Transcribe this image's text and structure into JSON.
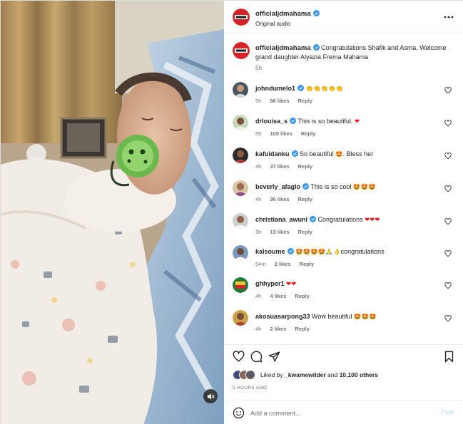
{
  "post": {
    "author": "officialjdmahama",
    "audio": "Original audio",
    "caption": "Congratulations Shafik and Asma. Welcome grand daughter Alyazia Frema Mahama",
    "caption_time": "5h"
  },
  "comments": [
    {
      "user": "johndumelo1",
      "text": "",
      "emoji": "👏👏👏👏👏",
      "time": "5h",
      "likes": "86 likes",
      "reply": "Reply",
      "verified": true
    },
    {
      "user": "drlouisa_s",
      "text": "This is so beautiful. ",
      "emoji": "❤",
      "time": "5h",
      "likes": "105 likes",
      "reply": "Reply",
      "verified": true
    },
    {
      "user": "kafuidanku",
      "text": "So beautiful ",
      "emoji": "🤩",
      "text2": ". Bless her",
      "time": "4h",
      "likes": "37 likes",
      "reply": "Reply",
      "verified": true
    },
    {
      "user": "beverly_afaglo",
      "text": "This is so cool ",
      "emoji": "🤩🤩🤩",
      "time": "4h",
      "likes": "36 likes",
      "reply": "Reply",
      "verified": true
    },
    {
      "user": "christiana_awuni",
      "text": "Congratulations ",
      "emoji": "❤❤❤",
      "time": "3h",
      "likes": "13 likes",
      "reply": "Reply",
      "verified": true
    },
    {
      "user": "kalsoume",
      "text": "",
      "emoji": "🤩🤩🤩🤩🙏👌",
      "text2": "congratulations",
      "time": "54m",
      "likes": "2 likes",
      "reply": "Reply",
      "verified": true
    },
    {
      "user": "ghhyper1",
      "text": "",
      "emoji": "❤❤",
      "time": "4h",
      "likes": "4 likes",
      "reply": "Reply",
      "verified": false
    },
    {
      "user": "akosuasarpong33",
      "text": "Wow beautiful ",
      "emoji": "🤩🤩🤩",
      "time": "4h",
      "likes": "2 likes",
      "reply": "Reply",
      "verified": false
    }
  ],
  "likes": {
    "prefix": "Liked by ",
    "user": "_kwamewilder",
    "middle": " and ",
    "others": "10,100 others"
  },
  "posted_ago": "5 HOURS AGO",
  "composer": {
    "placeholder": "Add a comment...",
    "post_label": "Post"
  },
  "icons": {
    "more": "more-options-icon",
    "like": "heart-icon",
    "comment": "comment-icon",
    "share": "share-icon",
    "save": "bookmark-icon",
    "emoji": "emoji-icon",
    "mute": "muted-speaker-icon"
  },
  "colors": {
    "verified": "#3897f0",
    "meta": "#737373",
    "post_disabled": "#b2dffc",
    "heart_emoji": "#ed1b24"
  }
}
